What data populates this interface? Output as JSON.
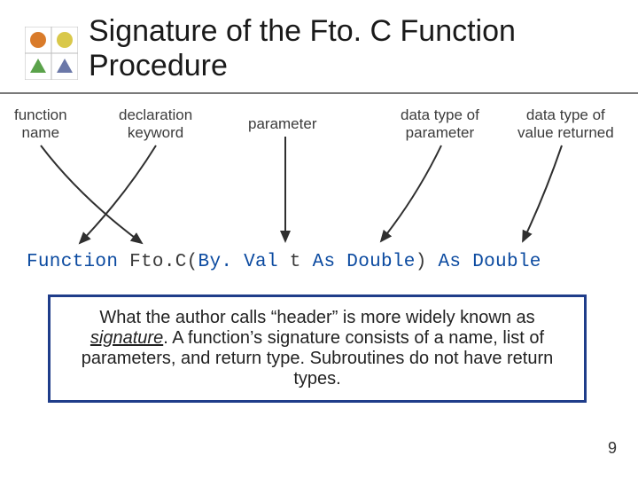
{
  "title": "Signature of the Fto. C\nFunction Procedure",
  "labels": {
    "fnname": "function\nname",
    "declkw": "declaration\nkeyword",
    "param": "parameter",
    "dtypeParam": "data type of\nparameter",
    "dtypeRet": "data type of\nvalue returned"
  },
  "code": {
    "kw_function": "Function",
    "sp1": " ",
    "name": "Fto.C",
    "open": "(",
    "kw_byval": "By. Val",
    "sp2": " ",
    "param": "t",
    "sp3": " ",
    "kw_as1": "As Double",
    "close": ")",
    "sp4": " ",
    "kw_as2": "As Double"
  },
  "note_text": "What the author calls “header” is more widely known as signature. A function’s signature consists of a name, list of parameters, and return type. Subroutines do not have return types.",
  "page_number": "9"
}
